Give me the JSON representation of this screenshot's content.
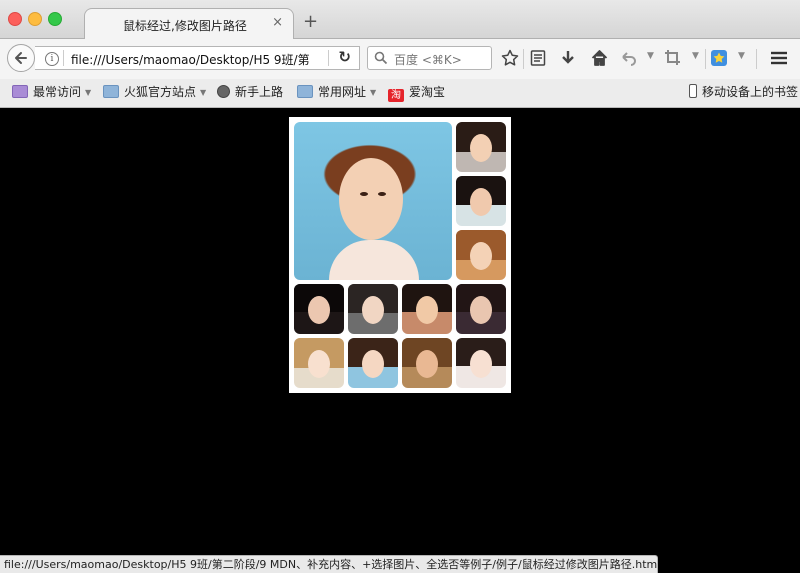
{
  "window": {
    "tab_title": "鼠标经过,修改图片路径",
    "tab_close": "×",
    "new_tab": "+"
  },
  "navbar": {
    "back_icon": "arrow-left-icon",
    "info_icon_glyph": "i",
    "url": "file:///Users/maomao/Desktop/H5 9班/第",
    "reload_glyph": "↻",
    "search_placeholder": "百度 <⌘K>",
    "toolbar_icons": [
      "star-icon",
      "reading-list-icon",
      "download-icon",
      "home-icon",
      "back-history-icon",
      "crop-icon",
      "extension-star-icon",
      "menu-icon"
    ]
  },
  "bookmarks": {
    "items": [
      {
        "label": "最常访问",
        "icon": "most-visited-icon",
        "has_dropdown": true
      },
      {
        "label": "火狐官方站点",
        "icon": "folder-icon",
        "has_dropdown": true
      },
      {
        "label": "新手上路",
        "icon": "globe-icon",
        "has_dropdown": false
      },
      {
        "label": "常用网址",
        "icon": "folder-icon",
        "has_dropdown": true
      },
      {
        "label": "爱淘宝",
        "icon": "taobao-icon",
        "has_dropdown": false
      }
    ],
    "mobile_label": "移动设备上的书签",
    "taobao_glyph": "淘"
  },
  "gallery": {
    "images": [
      "large-photo",
      "thumb-1",
      "thumb-2",
      "thumb-3",
      "thumb-4",
      "thumb-5",
      "thumb-6",
      "thumb-7",
      "thumb-8",
      "thumb-9",
      "thumb-10",
      "thumb-11"
    ]
  },
  "status": {
    "text": "file:///Users/maomao/Desktop/H5 9班/第二阶段/9 MDN、补充内容、+选择图片、全选否等例子/例子/鼠标经过修改图片路径.html#"
  },
  "colors": {
    "page_background": "#000000",
    "gallery_background": "#ffffff"
  }
}
